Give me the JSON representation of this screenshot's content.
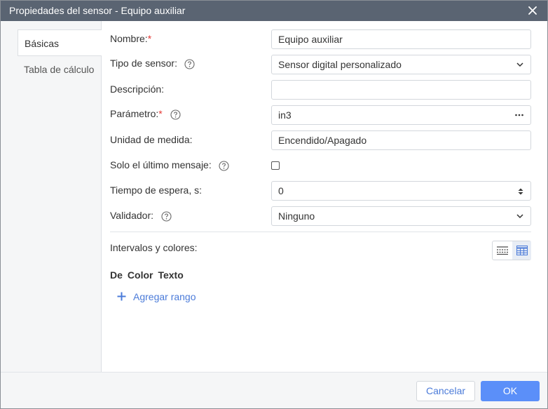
{
  "dialog": {
    "title": "Propiedades del sensor - Equipo auxiliar"
  },
  "tabs": [
    {
      "label": "Básicas",
      "active": true
    },
    {
      "label": "Tabla de cálculo",
      "active": false
    }
  ],
  "form": {
    "name": {
      "label": "Nombre:",
      "required": "*",
      "value": "Equipo auxiliar"
    },
    "sensor_type": {
      "label": "Tipo de sensor:",
      "value": "Sensor digital personalizado"
    },
    "description": {
      "label": "Descripción:",
      "value": ""
    },
    "parameter": {
      "label": "Parámetro:",
      "required": "*",
      "value": "in3"
    },
    "unit": {
      "label": "Unidad de medida:",
      "value": "Encendido/Apagado"
    },
    "last_message_only": {
      "label": "Solo el último mensaje:",
      "checked": false
    },
    "timeout": {
      "label": "Tiempo de espera, s:",
      "value": "0"
    },
    "validator": {
      "label": "Validador:",
      "value": "Ninguno"
    }
  },
  "intervals": {
    "label": "Intervalos y colores:",
    "columns": [
      "De",
      "Color",
      "Texto"
    ],
    "add_range": "Agregar rango"
  },
  "footer": {
    "cancel": "Cancelar",
    "ok": "OK"
  },
  "colors": {
    "titlebar": "#5a6472",
    "accent": "#5b8ff9",
    "link": "#4b7bd9",
    "required": "#e53935"
  }
}
